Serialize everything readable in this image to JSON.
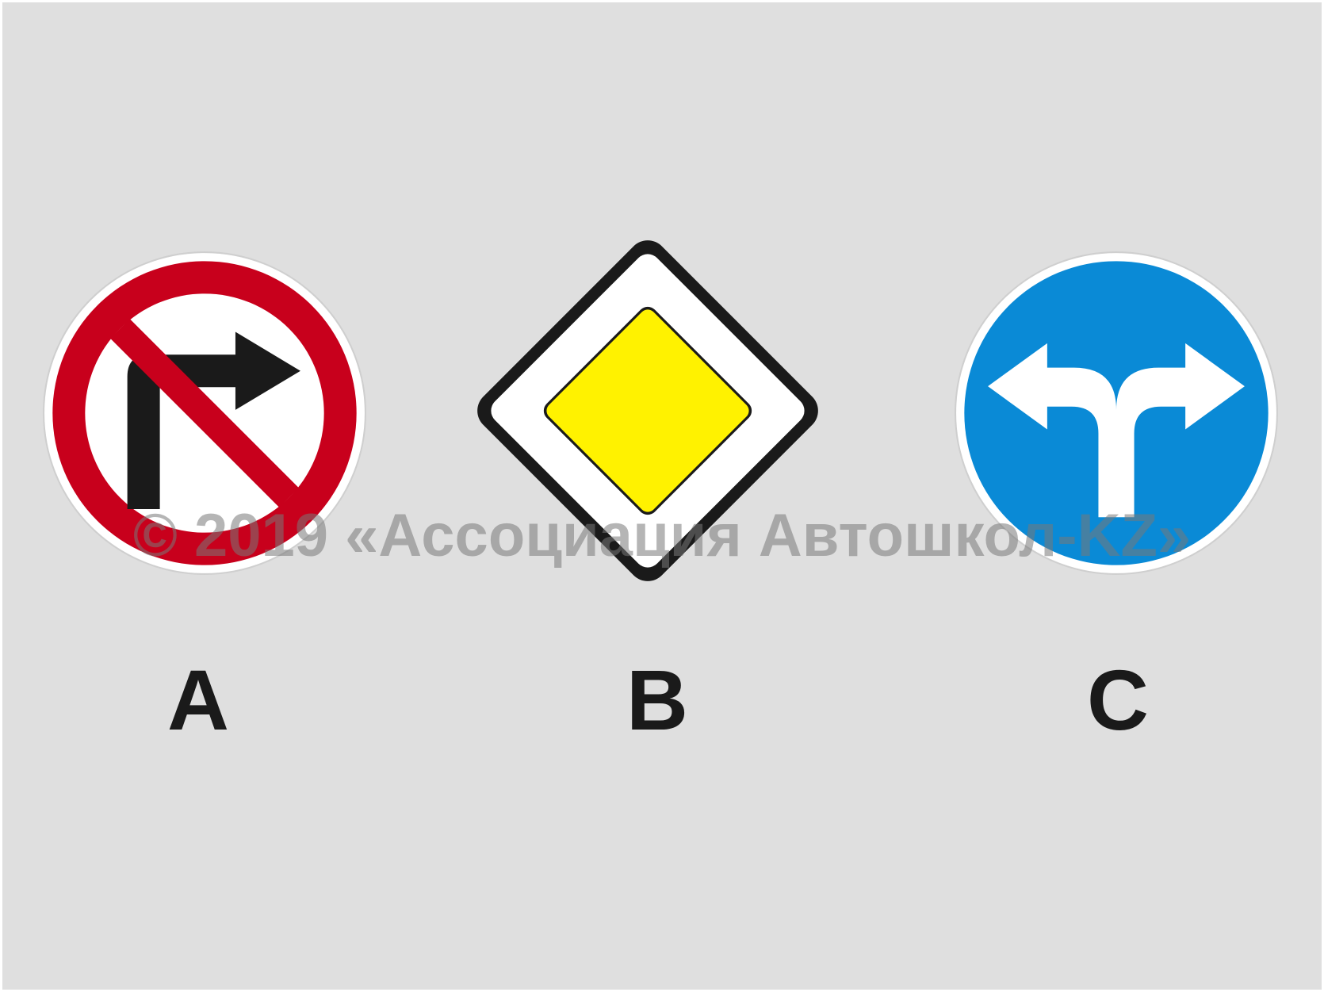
{
  "signs": [
    {
      "id": "A",
      "label": "A",
      "icon": "no-right-turn-sign-icon"
    },
    {
      "id": "B",
      "label": "B",
      "icon": "priority-road-sign-icon"
    },
    {
      "id": "C",
      "label": "C",
      "icon": "left-or-right-turn-sign-icon"
    }
  ],
  "watermark": "© 2019 «Ассоциация Автошкол-KZ»",
  "colors": {
    "background": "#dfdfdf",
    "prohibition_red": "#c8001c",
    "priority_yellow": "#fff200",
    "mandatory_blue": "#0a8ad6",
    "sign_black": "#1a1a1a",
    "sign_white": "#ffffff"
  }
}
